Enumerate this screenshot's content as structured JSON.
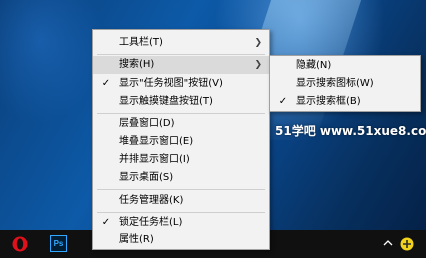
{
  "watermark": "51学吧 www.51xue8.com",
  "context_menu": {
    "items": [
      {
        "label": "工具栏(T)",
        "has_submenu": true,
        "checked": false
      },
      {
        "label": "搜索(H)",
        "has_submenu": true,
        "checked": false,
        "highlighted": true
      },
      {
        "label": "显示\"任务视图\"按钮(V)",
        "has_submenu": false,
        "checked": true
      },
      {
        "label": "显示触摸键盘按钮(T)",
        "has_submenu": false,
        "checked": false
      },
      {
        "label": "层叠窗口(D)",
        "has_submenu": false,
        "checked": false
      },
      {
        "label": "堆叠显示窗口(E)",
        "has_submenu": false,
        "checked": false
      },
      {
        "label": "并排显示窗口(I)",
        "has_submenu": false,
        "checked": false
      },
      {
        "label": "显示桌面(S)",
        "has_submenu": false,
        "checked": false
      },
      {
        "label": "任务管理器(K)",
        "has_submenu": false,
        "checked": false
      },
      {
        "label": "锁定任务栏(L)",
        "has_submenu": false,
        "checked": true
      },
      {
        "label": "属性(R)",
        "has_submenu": false,
        "checked": false
      }
    ],
    "check_glyph": "✓",
    "arrow_glyph": "❯"
  },
  "search_submenu": {
    "items": [
      {
        "label": "隐藏(N)",
        "checked": false
      },
      {
        "label": "显示搜索图标(W)",
        "checked": false
      },
      {
        "label": "显示搜索框(B)",
        "checked": true
      }
    ]
  },
  "taskbar": {
    "pinned": [
      {
        "name": "opera-icon"
      },
      {
        "name": "photoshop-icon",
        "text": "Ps"
      }
    ],
    "tray": [
      "chevron-up-icon",
      "tray-app-icon"
    ]
  }
}
